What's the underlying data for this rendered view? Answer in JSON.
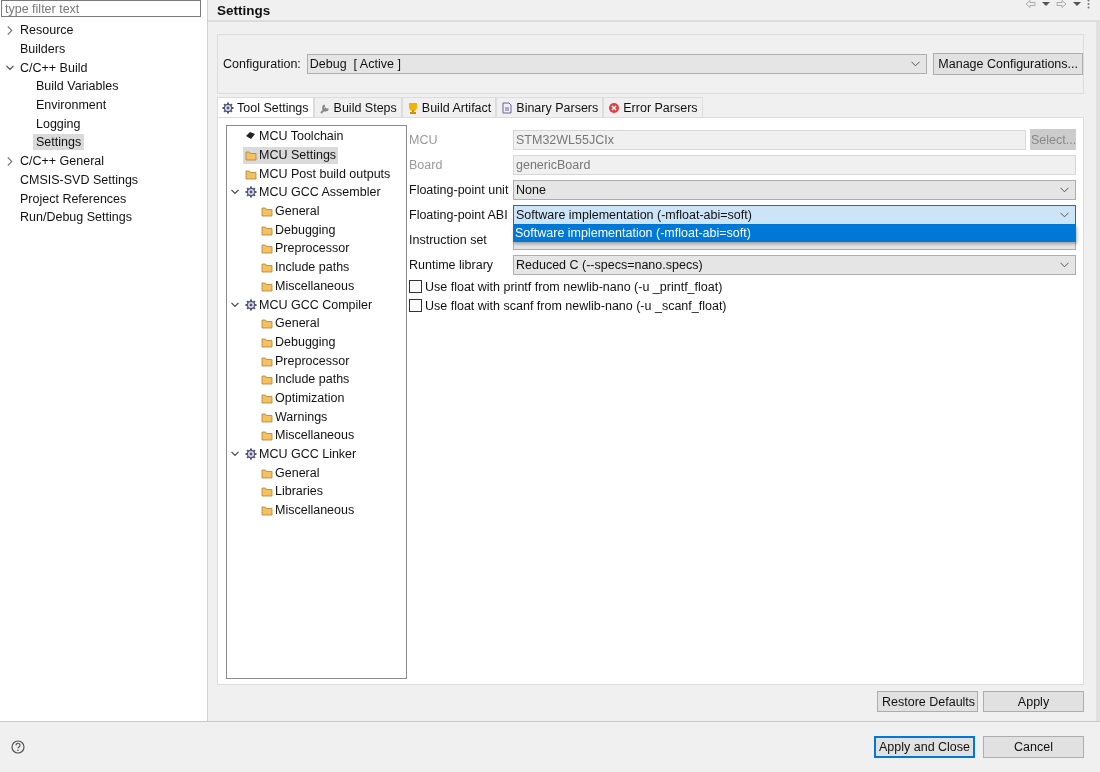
{
  "filter": {
    "placeholder": "type filter text"
  },
  "sidebar": {
    "items": [
      {
        "label": "Resource",
        "expanded": false,
        "selected": false
      },
      {
        "label": "Builders",
        "selected": false
      },
      {
        "label": "C/C++ Build",
        "expanded": true,
        "selected": false,
        "children": [
          {
            "label": "Build Variables",
            "selected": false
          },
          {
            "label": "Environment",
            "selected": false
          },
          {
            "label": "Logging",
            "selected": false
          },
          {
            "label": "Settings",
            "selected": true
          }
        ]
      },
      {
        "label": "C/C++ General",
        "expanded": false,
        "selected": false
      },
      {
        "label": "CMSIS-SVD Settings",
        "selected": false
      },
      {
        "label": "Project References",
        "selected": false
      },
      {
        "label": "Run/Debug Settings",
        "selected": false
      }
    ]
  },
  "page": {
    "title": "Settings"
  },
  "configuration": {
    "label": "Configuration:",
    "value": "Debug  [ Active ]",
    "button": "Manage Configurations..."
  },
  "tabs": [
    {
      "label": "Tool Settings",
      "kind": "tool",
      "selected": true
    },
    {
      "label": "Build Steps",
      "kind": "steps",
      "selected": false
    },
    {
      "label": "Build Artifact",
      "kind": "artifact",
      "selected": false
    },
    {
      "label": "Binary Parsers",
      "kind": "binary",
      "selected": false
    },
    {
      "label": "Error Parsers",
      "kind": "error",
      "selected": false
    }
  ],
  "tool_tree": [
    {
      "label": "MCU Toolchain",
      "kind": "toolchain",
      "selected": false
    },
    {
      "label": "MCU Settings",
      "kind": "option",
      "selected": true
    },
    {
      "label": "MCU Post build outputs",
      "kind": "option",
      "selected": false
    },
    {
      "label": "MCU GCC Assembler",
      "kind": "tool",
      "expanded": true,
      "selected": false,
      "children": [
        {
          "label": "General",
          "kind": "option",
          "selected": false
        },
        {
          "label": "Debugging",
          "kind": "option",
          "selected": false
        },
        {
          "label": "Preprocessor",
          "kind": "option",
          "selected": false
        },
        {
          "label": "Include paths",
          "kind": "option",
          "selected": false
        },
        {
          "label": "Miscellaneous",
          "kind": "option",
          "selected": false
        }
      ]
    },
    {
      "label": "MCU GCC Compiler",
      "kind": "tool",
      "expanded": true,
      "selected": false,
      "children": [
        {
          "label": "General",
          "kind": "option",
          "selected": false
        },
        {
          "label": "Debugging",
          "kind": "option",
          "selected": false
        },
        {
          "label": "Preprocessor",
          "kind": "option",
          "selected": false
        },
        {
          "label": "Include paths",
          "kind": "option",
          "selected": false
        },
        {
          "label": "Optimization",
          "kind": "option",
          "selected": false
        },
        {
          "label": "Warnings",
          "kind": "option",
          "selected": false
        },
        {
          "label": "Miscellaneous",
          "kind": "option",
          "selected": false
        }
      ]
    },
    {
      "label": "MCU GCC Linker",
      "kind": "tool",
      "expanded": true,
      "selected": false,
      "children": [
        {
          "label": "General",
          "kind": "option",
          "selected": false
        },
        {
          "label": "Libraries",
          "kind": "option",
          "selected": false
        },
        {
          "label": "Miscellaneous",
          "kind": "option",
          "selected": false
        }
      ]
    }
  ],
  "form": [
    {
      "kind": "text",
      "label": "MCU",
      "value": "STM32WL55JCIx",
      "disabled": true,
      "button": "Select..."
    },
    {
      "kind": "text",
      "label": "Board",
      "value": "genericBoard",
      "disabled": true
    },
    {
      "kind": "combo",
      "label": "Floating-point unit",
      "value": "None",
      "focused": false
    },
    {
      "kind": "combo",
      "label": "Floating-point ABI",
      "value": "Software implementation (-mfloat-abi=soft)",
      "focused": true,
      "options": [
        {
          "label": "Software implementation (-mfloat-abi=soft)",
          "selected": true
        }
      ]
    },
    {
      "kind": "combo",
      "label": "Instruction set",
      "focused": false
    },
    {
      "kind": "combo",
      "label": "Runtime library",
      "value": "Reduced C (--specs=nano.specs)",
      "focused": false
    },
    {
      "kind": "check",
      "label": "Use float with printf from newlib-nano (-u _printf_float)",
      "checked": false
    },
    {
      "kind": "check",
      "label": "Use float with scanf from newlib-nano (-u _scanf_float)",
      "checked": false
    }
  ],
  "page_buttons": [
    "Restore Defaults",
    "Apply"
  ],
  "dialog_buttons": [
    {
      "label": "Apply and Close",
      "default": true
    },
    {
      "label": "Cancel",
      "default": false
    }
  ]
}
